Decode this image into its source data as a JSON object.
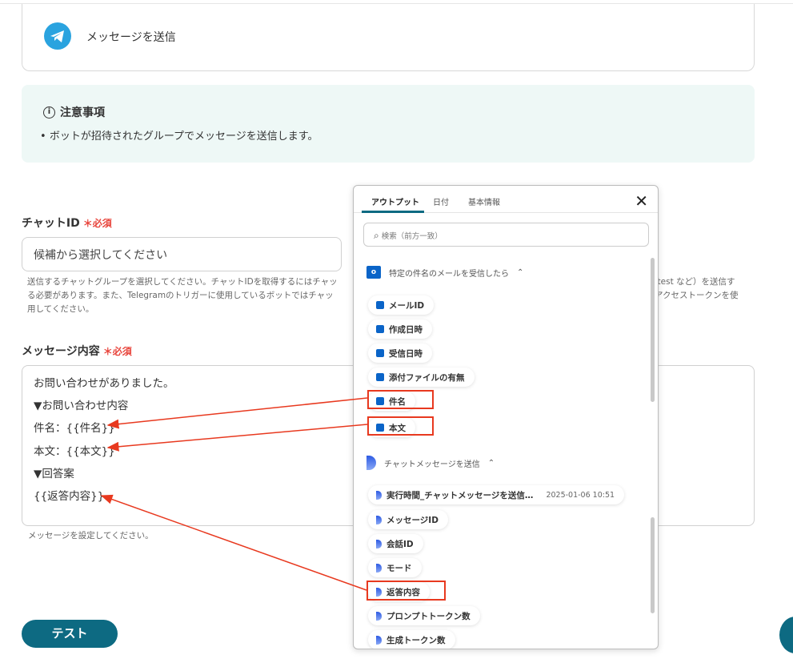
{
  "card": {
    "title": "メッセージを送信"
  },
  "notice": {
    "title": "注意事項",
    "items": [
      "ボットが招待されたグループでメッセージを送信します。"
    ]
  },
  "chat_id": {
    "label": "チャットID",
    "required": "必須",
    "placeholder": "候補から選択してください",
    "help_left": [
      "送信するチャットグループを選択してください。チャットIDを取得するにはチャッ",
      "る必要があります。また、Telegramのトリガーに使用しているボットではチャッ",
      "用してください。"
    ],
    "help_right": [
      "/test など）を送信す",
      "アクセストークンを使"
    ]
  },
  "message": {
    "label": "メッセージ内容",
    "required": "必須",
    "lines": [
      "お問い合わせがありました。",
      "▼お問い合わせ内容",
      "件名：{{件名}}",
      "本文：{{本文}}",
      "▼回答案",
      "{{返答内容}}"
    ],
    "help": "メッセージを設定してください。"
  },
  "test_button": "テスト",
  "panel": {
    "tabs": [
      "アウトプット",
      "日付",
      "基本情報"
    ],
    "search_placeholder": "検索（前方一致）",
    "sections": [
      {
        "title": "特定の件名のメールを受信したら",
        "icon": "outlook-icon",
        "items": [
          "メールID",
          "作成日時",
          "受信日時",
          "添付ファイルの有無",
          "件名",
          "本文"
        ]
      },
      {
        "title": "チャットメッセージを送信",
        "icon": "yoom-ai-icon",
        "items": [
          "実行時間_チャットメッセージを送信…",
          "メッセージID",
          "会話ID",
          "モード",
          "返答内容",
          "プロンプトトークン数",
          "生成トークン数"
        ],
        "first_item_value": "2025-01-06 10:51"
      }
    ]
  },
  "colors": {
    "accent": "#0d6a82",
    "highlight": "#e8391f",
    "required": "#e8453c"
  }
}
